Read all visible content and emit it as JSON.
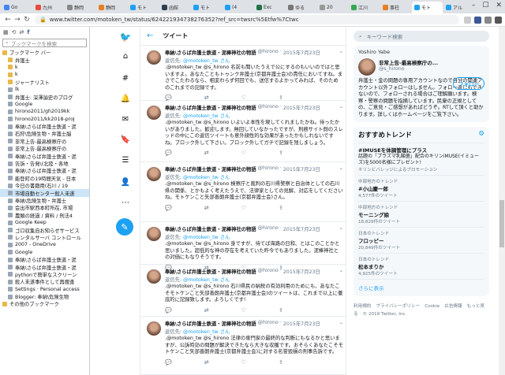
{
  "tabs": [
    {
      "label": "Go"
    },
    {
      "label": "九州"
    },
    {
      "label": "静岡"
    },
    {
      "label": "静岡"
    },
    {
      "label": "モト"
    },
    {
      "label": "函館"
    },
    {
      "label": "モト"
    },
    {
      "label": "(4"
    },
    {
      "label": "Exc"
    },
    {
      "label": "ゆる"
    },
    {
      "label": "20"
    },
    {
      "label": "江川"
    },
    {
      "label": "事柱"
    },
    {
      "label": "モト"
    },
    {
      "label": "アル"
    }
  ],
  "address": {
    "url": "www.twitter.com/motoken_tw/status/624221934738276352?ref_src=twsrc%5Etfw%7Ctwc"
  },
  "sidebar": {
    "search_placeholder": "ブックマークを検索",
    "items": [
      {
        "label": "ブックマーク バー",
        "type": "folder"
      },
      {
        "label": "弁護士",
        "type": "folder"
      },
      {
        "label": "k",
        "type": "folder"
      },
      {
        "label": "k",
        "type": "folder"
      },
      {
        "label": "ジャーナリスト",
        "type": "folder"
      },
      {
        "label": "lk",
        "type": "page"
      },
      {
        "label": "弁護士: 深澤諭史のブログ",
        "type": "page"
      },
      {
        "label": "Google",
        "type": "page"
      },
      {
        "label": "hirono2011/gh2019kk",
        "type": "page"
      },
      {
        "label": "hirono2011/kk2018-proj",
        "type": "page"
      },
      {
        "label": "奉納\\さらば弁護士鉄道・泥",
        "type": "page"
      },
      {
        "label": "石狩\\危険生物・弁護士脳",
        "type": "page"
      },
      {
        "label": "非常上告-最高検察庁の",
        "type": "page"
      },
      {
        "label": "非常上告-最高検察庁の",
        "type": "page"
      },
      {
        "label": "奉納\\さらば弁護士鉄道・泥",
        "type": "page"
      },
      {
        "label": "告訴・告発\\(北陸・各地",
        "type": "page"
      },
      {
        "label": "奉納\\さらば弁護士鉄道・泥",
        "type": "page"
      },
      {
        "label": "能登町の19時間天気 - 日本",
        "type": "page"
      },
      {
        "label": "今日の書籍用(石川 / 19",
        "type": "page"
      },
      {
        "label": "市場自動センター殺人未遂",
        "type": "page",
        "selected": true
      },
      {
        "label": "奉納\\危険生物・弁護士",
        "type": "page"
      },
      {
        "label": "会出市駅西本町所在, 市場",
        "type": "page"
      },
      {
        "label": "農類の経過 / 資料 / 刑法4",
        "type": "page"
      },
      {
        "label": "Google Keep",
        "type": "page"
      },
      {
        "label": "ゴロ収集自お知らせサービス",
        "type": "page"
      },
      {
        "label": "レンタルサーバ コントロール",
        "type": "page"
      },
      {
        "label": "2007 - OneDrive",
        "type": "page"
      },
      {
        "label": "Google",
        "type": "page"
      },
      {
        "label": "奉納\\さらば弁護士鉄道・泥",
        "type": "page"
      },
      {
        "label": "奉納\\さらば弁護士鉄道・泥",
        "type": "page"
      },
      {
        "label": "pythonで簡単なスクリーン",
        "type": "page"
      },
      {
        "label": "殺人未遂事件として再捜査",
        "type": "page"
      },
      {
        "label": "Settings · Personal access",
        "type": "page"
      },
      {
        "label": "Blogger: 奉納\\危険生物",
        "type": "page"
      },
      {
        "label": "その他のブックマーク",
        "type": "folder"
      }
    ]
  },
  "header": {
    "title": "ツイート"
  },
  "tweets": [
    {
      "name": "奉納\\さらば弁護士鉄道・泥棒神社の物語",
      "handle": "@hirono",
      "date": "2015年7月23日",
      "reply_label": "返信先:",
      "reply_to": "@motoken_tw さん",
      "text": ".@motoken_tw @s_hirono 名前も聞いたうえで公にするのもいいのではと思いますよ。あなたこともトゥンク弁護士(京都弁護士会)の責任においてすね。まさでこたわるなら、相変わらず何回でも、送信するよかってみれば、そのためのこれまでの記録です。"
    },
    {
      "name": "奉納\\さらば弁護士鉄道・泥棒神社の物語",
      "handle": "@hirono",
      "date": "2015年7月23日",
      "reply_label": "返信先:",
      "reply_to": "@motoken_tw さん",
      "text": ".@motoken_tw @s_hirono いよいよ本性を現してくれましたかね。待ったかいがありました。歓迎します。無回していなかったですが、刑務サイト側のスレッドの中にこの返信ツイートも意外顔性的な効果があったかもしれないですね。ブロック外して下さい。ブロック外してガチで記録を残しましょう。"
    },
    {
      "name": "奉納\\さらば弁護士鉄道・泥棒神社の物語",
      "handle": "@hirono",
      "date": "2015年7月23日",
      "reply_label": "返信先:",
      "reply_to": "@motoken_tw さん",
      "text": ".@motoken_tw @s_hirono 検察庁と裁判の石川県警察と自治体としての石川県の関係、とかもよく考えたうえで、法律家としての見解、対応をしてくださいね。モトケンこと矢部善朗弁護士(京都弁護士会)さん。"
    },
    {
      "name": "奉納\\さらば弁護士鉄道・泥棒神社の物語",
      "handle": "@hirono",
      "date": "2015年7月23日",
      "reply_label": "返信先:",
      "reply_to": "@motoken_tw さん",
      "text": ".@motoken_tw @s_hirono 身ですが、待てば海路の日和、とはこのことかと思いました。超低的な神の存在を考えていた昨今でもありました。泥棒神社との対価にもなりそうです。"
    },
    {
      "name": "奉納\\さらば弁護士鉄道・泥棒神社の物語",
      "handle": "@hirono",
      "date": "2015年7月23日",
      "reply_label": "返信先:",
      "reply_to": "@motoken_tw さん",
      "text": ".@motoken_tw @s_hirono 石川県民の納税の有効利用のためにも、あなたこそモトケンこと矢部善朗弁護士(京都弁護士会)のツイートは、これまで以上に徹底的に記録致します。よろしくです!"
    },
    {
      "name": "奉納\\さらば弁護士鉄道・泥棒神社の物語",
      "handle": "@hirono",
      "date": "2015年7月23日",
      "reply_label": "返信先:",
      "reply_to": "@motoken_tw さん",
      "text": ".@motoken_tw @s_hirono 法律の専門家の最終的な判断にもなるかと思いますが、公訴時効の問題が解決できたなら大きな収穫です。おそらくあなたこそモトケンこと矢部善朗弁護士(京都弁護士会)に対する名誉毀損の刑事告訴です。"
    }
  ],
  "right": {
    "search_placeholder": "キーワード検索",
    "profile": {
      "top_label": "Yoshiro Yabe",
      "name": "非常上告-最高検察庁の...",
      "handle": "@s_hirono",
      "follow_label": "フォロー",
      "bio": "弁護士・金の問題の専用アカウントなので自分の関連アカウント以外フォローはしません。フォロー返しもできないので、フォローされる場合はご理解願います。検察・警察の問題を指摘しています。民衆の正規としての、ご意見・ご感想があればどうぞ。RTして頂くと助かります。詳しくはホームページをご覧下さい。"
    },
    "trends_title": "おすすめトレンド",
    "trends": [
      {
        "meta": "",
        "name": "#IMUSEを体調管理にプラス",
        "desc": "話題の「プラズマ乳酸菌」配合のキリンiMUSE(イミューズ)を5000名様にプレゼント!",
        "count": "",
        "promo": "キリンビバレッジによるプロモーション"
      },
      {
        "meta": "中部地方のトレンド",
        "name": "#小山慶一郎",
        "desc": "",
        "count": "4,577件のツイート",
        "promo": ""
      },
      {
        "meta": "中部地方のトレンド",
        "name": "モーニング娘",
        "desc": "",
        "count": "18,829件のツイート",
        "promo": ""
      },
      {
        "meta": "日本のトレンド",
        "name": "フロッピー",
        "desc": "",
        "count": "20,849件のツイート",
        "promo": ""
      },
      {
        "meta": "日本のトレンド",
        "name": "松本まりか",
        "desc": "",
        "count": "4,925件のツイート",
        "promo": ""
      }
    ],
    "more_label": "さらに表示",
    "footer": [
      "利用規約",
      "プライバシーポリシー",
      "Cookie",
      "広告情報",
      "もっと見る",
      "© 2019 Twitter, Inc."
    ]
  }
}
